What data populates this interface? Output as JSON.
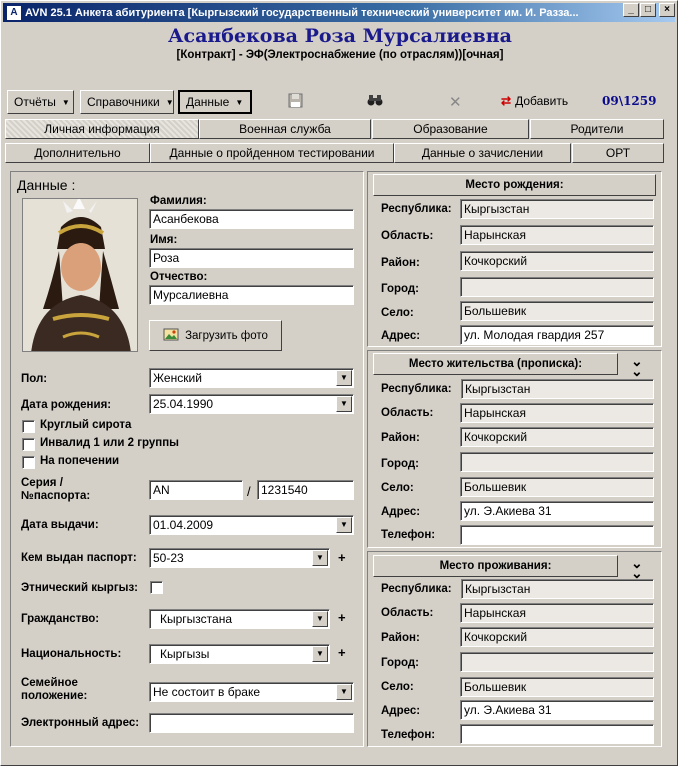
{
  "window": {
    "title": "AVN 25.1 Анкета абитуриента [Кыргызский государственный технический университет им. И. Разза...",
    "min": "_",
    "max": "□",
    "close": "×"
  },
  "header": {
    "name": "Асанбекова Роза Мурсалиевна",
    "program": "[Контракт] - ЭФ(Электроснабжение (по отраслям))[очная]"
  },
  "toolbar": {
    "reports": "Отчёты",
    "references": "Справочники",
    "data": "Данные",
    "add": "Добавить",
    "code": "09\\1259",
    "save_icon": "floppy-icon",
    "search_icon": "binoculars-icon",
    "delete_icon": "x-icon"
  },
  "tabs_row1": [
    "Личная информация",
    "Военная служба",
    "Образование",
    "Родители"
  ],
  "tabs_row2": [
    "Дополнительно",
    "Данные о пройденном тестировании",
    "Данные о зачислении",
    "ОРТ"
  ],
  "left": {
    "heading": "Данные :",
    "surname_label": "Фамилия:",
    "surname": "Асанбекова",
    "firstname_label": "Имя:",
    "firstname": "Роза",
    "patronymic_label": "Отчество:",
    "patronymic": "Мурсалиевна",
    "load_photo": "Загрузить фото",
    "gender_label": "Пол:",
    "gender": "Женский",
    "birth_label": "Дата рождения:",
    "birth": "25.04.1990",
    "orphan": "Круглый сирота",
    "disabled": "Инвалид 1 или 2 группы",
    "guardianship": "На попечении",
    "passport_label_1": "Серия /",
    "passport_label_2": "№паспорта:",
    "passport_series": "AN",
    "passport_sep": "/",
    "passport_number": "1231540",
    "issue_date_label": "Дата выдачи:",
    "issue_date": "01.04.2009",
    "issued_by_label": "Кем выдан паспорт:",
    "issued_by": "50-23",
    "ethnic_label": "Этнический кыргыз:",
    "citizenship_label": "Гражданство:",
    "citizenship": "Кыргызстана",
    "nationality_label": "Национальность:",
    "nationality": "Кыргызы",
    "marital_label_1": "Семейное",
    "marital_label_2": "положение:",
    "marital": "Не состоит в браке",
    "email_label": "Электронный адрес:",
    "email": "",
    "plus": "+"
  },
  "birthplace": {
    "title": "Место рождения:",
    "rows": [
      {
        "label": "Республика:",
        "value": "Кыргызстан"
      },
      {
        "label": "Область:",
        "value": "Нарынская"
      },
      {
        "label": "Район:",
        "value": "Кочкорский"
      },
      {
        "label": "Город:",
        "value": ""
      },
      {
        "label": "Село:",
        "value": "Большевик"
      },
      {
        "label": "Адрес:",
        "value": "ул. Молодая гвардия 257"
      }
    ]
  },
  "registration": {
    "title": "Место жительства (прописка):",
    "rows": [
      {
        "label": "Республика:",
        "value": "Кыргызстан"
      },
      {
        "label": "Область:",
        "value": "Нарынская"
      },
      {
        "label": "Район:",
        "value": "Кочкорский"
      },
      {
        "label": "Город:",
        "value": ""
      },
      {
        "label": "Село:",
        "value": "Большевик"
      },
      {
        "label": "Адрес:",
        "value": "ул. Э.Акиева 31"
      },
      {
        "label": "Телефон:",
        "value": ""
      }
    ]
  },
  "residence": {
    "title": "Место проживания:",
    "rows": [
      {
        "label": "Республика:",
        "value": "Кыргызстан"
      },
      {
        "label": "Область:",
        "value": "Нарынская"
      },
      {
        "label": "Район:",
        "value": "Кочкорский"
      },
      {
        "label": "Город:",
        "value": ""
      },
      {
        "label": "Село:",
        "value": "Большевик"
      },
      {
        "label": "Адрес:",
        "value": "ул. Э.Акиева 31"
      },
      {
        "label": "Телефон:",
        "value": ""
      }
    ]
  },
  "icons": {
    "expand": "double-chevron-down-icon",
    "dropdown": "chevron-down-icon",
    "photo": "photo-icon"
  }
}
